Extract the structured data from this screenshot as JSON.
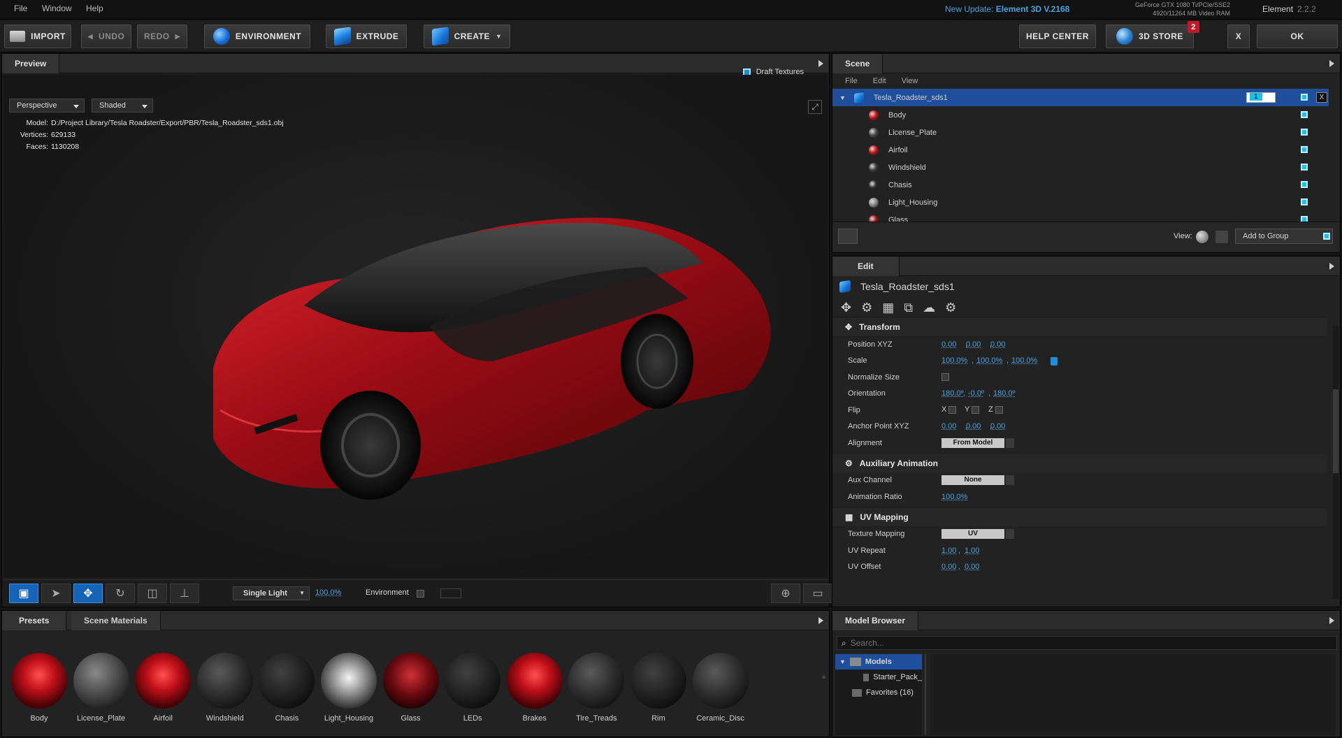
{
  "menubar": {
    "items": [
      "File",
      "Window",
      "Help"
    ],
    "update_prefix": "New Update:",
    "update_version": "Element 3D V.2168",
    "gpu_line1": "GeForce GTX 1080 Ti/PCIe/SSE2",
    "gpu_line2": "4920/11264 MB Video RAM",
    "app_name": "Element",
    "app_version": "2.2.2"
  },
  "toolbar": {
    "import": "IMPORT",
    "undo": "UNDO",
    "redo": "REDO",
    "environment": "ENVIRONMENT",
    "extrude": "EXTRUDE",
    "create": "CREATE",
    "help_center": "HELP CENTER",
    "store": "3D STORE",
    "store_badge": "2",
    "close": "X",
    "ok": "OK"
  },
  "preview": {
    "tab": "Preview",
    "draft_textures": "Draft Textures",
    "camera_view": "Perspective",
    "shading": "Shaded",
    "model_label": "Model:",
    "model_value": "D:/Project Library/Tesla Roadster/Export/PBR/Tesla_Roadster_sds1.obj",
    "vertices_label": "Vertices:",
    "vertices_value": "629133",
    "faces_label": "Faces:",
    "faces_value": "1130208",
    "light_mode": "Single Light",
    "light_value": "100.0%",
    "environment_label": "Environment"
  },
  "scene": {
    "tab": "Scene",
    "menu": [
      "File",
      "Edit",
      "View"
    ],
    "group_name": "Tesla_Roadster_sds1",
    "group_index": "1",
    "group_close": "X",
    "items": [
      {
        "name": "Body",
        "color": "#c8141c"
      },
      {
        "name": "License_Plate",
        "color": "#4a4a4a"
      },
      {
        "name": "Airfoil",
        "color": "#c8141c"
      },
      {
        "name": "Windshield",
        "color": "#3a3a3a"
      },
      {
        "name": "Chasis",
        "color": "#2a2a2a"
      },
      {
        "name": "Light_Housing",
        "color": "#8a8a8a"
      },
      {
        "name": "Glass",
        "color": "#a01018"
      }
    ],
    "view_label": "View:",
    "add_to_group": "Add to Group"
  },
  "edit": {
    "tab": "Edit",
    "object_name": "Tesla_Roadster_sds1",
    "transform": {
      "title": "Transform",
      "position_label": "Position XYZ",
      "position": [
        "0.00",
        "0.00",
        "0.00"
      ],
      "scale_label": "Scale",
      "scale": [
        "100.0%",
        "100.0%",
        "100.0%"
      ],
      "normalize_label": "Normalize Size",
      "orientation_label": "Orientation",
      "orientation": [
        "180.0º",
        "-0.0º",
        "180.0º"
      ],
      "flip_label": "Flip",
      "flip_axes": [
        "X",
        "Y",
        "Z"
      ],
      "anchor_label": "Anchor Point XYZ",
      "anchor": [
        "0.00",
        "0.00",
        "0.00"
      ],
      "alignment_label": "Alignment",
      "alignment_value": "From Model"
    },
    "aux": {
      "title": "Auxiliary Animation",
      "channel_label": "Aux Channel",
      "channel_value": "None",
      "ratio_label": "Animation Ratio",
      "ratio_value": "100.0%"
    },
    "uv": {
      "title": "UV Mapping",
      "mapping_label": "Texture Mapping",
      "mapping_value": "UV",
      "repeat_label": "UV Repeat",
      "repeat": [
        "1.00",
        "1.00"
      ],
      "offset_label": "UV Offset",
      "offset": [
        "0.00",
        "0.00"
      ]
    }
  },
  "presets": {
    "tabs": [
      "Presets",
      "Scene Materials"
    ],
    "materials": [
      {
        "name": "Body",
        "style": "red"
      },
      {
        "name": "License_Plate",
        "style": "grey"
      },
      {
        "name": "Airfoil",
        "style": "red"
      },
      {
        "name": "Windshield",
        "style": "dark"
      },
      {
        "name": "Chasis",
        "style": "darker"
      },
      {
        "name": "Light_Housing",
        "style": "chrome"
      },
      {
        "name": "Glass",
        "style": "redglass"
      },
      {
        "name": "LEDs",
        "style": "darker"
      },
      {
        "name": "Brakes",
        "style": "red"
      },
      {
        "name": "Tire_Treads",
        "style": "dark"
      },
      {
        "name": "Rim",
        "style": "darker"
      },
      {
        "name": "Ceramic_Disc",
        "style": "dark"
      }
    ]
  },
  "browser": {
    "tab": "Model Browser",
    "search_placeholder": "Search...",
    "tree": {
      "root": "Models",
      "child": "Starter_Pack_",
      "favorites": "Favorites (16)"
    }
  }
}
